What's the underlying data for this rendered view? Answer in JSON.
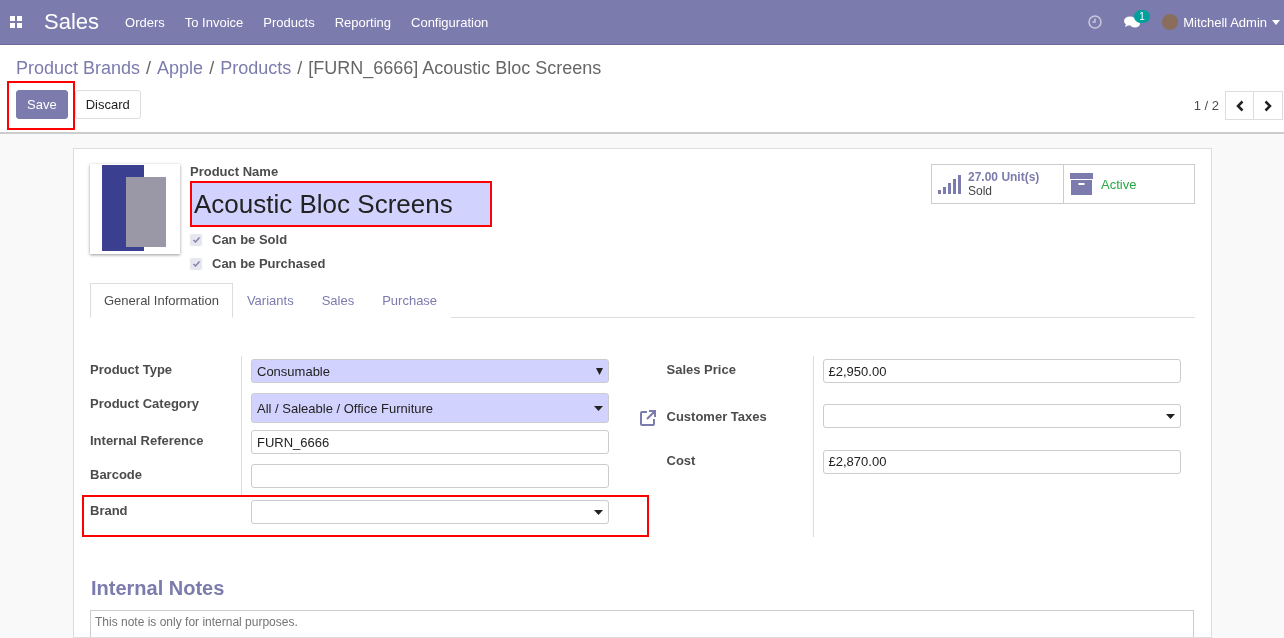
{
  "navbar": {
    "app_title": "Sales",
    "menu": [
      {
        "label": "Orders"
      },
      {
        "label": "To Invoice"
      },
      {
        "label": "Products"
      },
      {
        "label": "Reporting"
      },
      {
        "label": "Configuration"
      }
    ],
    "chat_badge": "1",
    "user": "Mitchell Admin"
  },
  "breadcrumbs": [
    {
      "label": "Product Brands",
      "kind": "link"
    },
    {
      "label": "Apple",
      "kind": "link",
      "separator": "/"
    },
    {
      "label": "Products",
      "kind": "link",
      "separator": "/"
    },
    {
      "label": "[FURN_6666] Acoustic Bloc Screens",
      "kind": "current",
      "separator": "/"
    }
  ],
  "buttons": [
    {
      "label": "Save",
      "kind": "primary",
      "highlighted": true
    },
    {
      "label": "Discard",
      "kind": "secondary",
      "highlighted": false
    }
  ],
  "pager": "1 / 2",
  "stat_buttons": [
    {
      "kind": "sold",
      "value": "27.00",
      "unit": "Unit(s)",
      "label": "Sold"
    },
    {
      "kind": "active",
      "label": "Active"
    }
  ],
  "product_name": {
    "label": "Product Name",
    "value": "Acoustic Bloc Screens",
    "highlighted": true
  },
  "checkboxes": [
    {
      "label": "Can be Sold",
      "checked": true
    },
    {
      "label": "Can be Purchased",
      "checked": true
    }
  ],
  "tabs": [
    {
      "label": "General Information",
      "selected": true
    },
    {
      "label": "Variants",
      "selected": false
    },
    {
      "label": "Sales",
      "selected": false
    },
    {
      "label": "Purchase",
      "selected": false
    }
  ],
  "left_fields": [
    {
      "label": "Product Type",
      "kind": "select",
      "value": "Consumable",
      "required": true,
      "highlighted": false
    },
    {
      "label": "Product Category",
      "kind": "many2one",
      "value": "All / Saleable / Office Furniture",
      "required": true,
      "highlighted": false,
      "external_link": true
    },
    {
      "label": "Internal Reference",
      "kind": "text",
      "value": "FURN_6666",
      "required": false,
      "highlighted": false
    },
    {
      "label": "Barcode",
      "kind": "text",
      "required": false,
      "highlighted": false
    },
    {
      "label": "Brand",
      "kind": "many2one",
      "required": false,
      "highlighted": true
    }
  ],
  "right_fields": [
    {
      "label": "Sales Price",
      "kind": "text",
      "value": "£2,950.00",
      "required": false,
      "highlighted": false
    },
    {
      "label": "Customer Taxes",
      "kind": "many2one",
      "required": false,
      "highlighted": false
    },
    {
      "label": "Cost",
      "kind": "text",
      "value": "£2,870.00",
      "required": false,
      "highlighted": false
    }
  ],
  "internal_notes": {
    "title": "Internal Notes",
    "placeholder": "This note is only for internal purposes."
  }
}
